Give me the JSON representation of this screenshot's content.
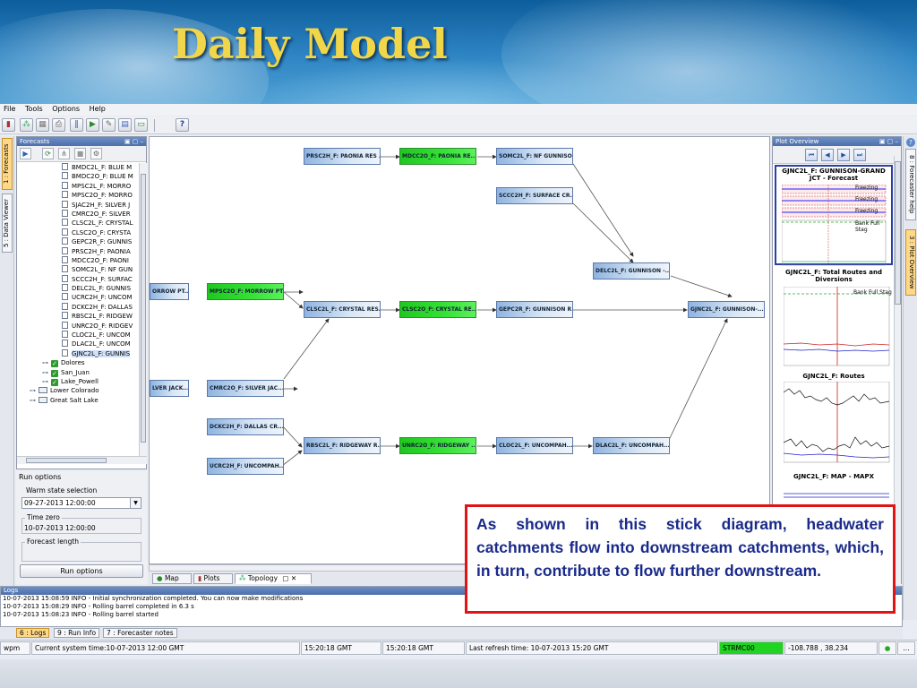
{
  "slide": {
    "title": "Daily Model"
  },
  "menu": [
    "File",
    "Tools",
    "Options",
    "Help"
  ],
  "toolbar": {
    "help_label": "?"
  },
  "left_tabs": [
    "1 : Forecasts",
    "5 : Data Viewer"
  ],
  "right_tabs": [
    "8 : Forecaster help",
    "3 : Plot Overview"
  ],
  "forecasts_panel": {
    "title": "Forecasts",
    "tree_items": [
      "BMDC2L_F: BLUE M",
      "BMDC2O_F: BLUE M",
      "MPSC2L_F: MORRO",
      "MPSC2O_F: MORRO",
      "SJAC2H_F: SILVER J",
      "CMRC2O_F: SILVER",
      "CLSC2L_F: CRYSTAL",
      "CLSC2O_F: CRYSTA",
      "GEPC2R_F: GUNNIS",
      "PRSC2H_F: PAONIA",
      "MDCC2O_F: PAONI",
      "SOMC2L_F: NF GUN",
      "SCCC2H_F: SURFAC",
      "DELC2L_F: GUNNIS",
      "UCRC2H_F: UNCOM",
      "DCKC2H_F: DALLAS",
      "RBSC2L_F: RIDGEW",
      "UNRC2O_F: RIDGEV",
      "CLOC2L_F: UNCOM",
      "DLAC2L_F: UNCOM",
      "GJNC2L_F: GUNNIS"
    ],
    "checked_groups": [
      "Dolores",
      "San_Juan",
      "Lake_Powell"
    ],
    "folder_groups": [
      "Lower Colorado",
      "Great Salt Lake"
    ]
  },
  "run_options": {
    "title": "Run options",
    "warm_state_label": "Warm state selection",
    "warm_state_value": "09-27-2013 12:00:00",
    "time_zero_label": "Time zero",
    "time_zero_value": "10-07-2013 12:00:00",
    "forecast_length_label": "Forecast length",
    "button_label": "Run options"
  },
  "topology_nodes": {
    "prsc2h": "PRSC2H_F: PAONIA RES ...",
    "mdcc2o": "MDCC2O_F: PAONIA RE...",
    "somc2l": "SOMC2L_F: NF GUNNISO...",
    "sccc2h": "SCCC2H_F: SURFACE CR...",
    "delc2l": "DELC2L_F: GUNNISON -...",
    "morrow": "ORROW PT...",
    "mpsc2o": "MPSC2O_F: MORROW PT...",
    "clsc2l": "CLSC2L_F: CRYSTAL RES...",
    "clsc2o": "CLSC2O_F: CRYSTAL RE...",
    "gepc2r": "GEPC2R_F: GUNNISON R...",
    "gjnc2l": "GJNC2L_F: GUNNISON-...",
    "silver": "LVER JACK...",
    "cmrc2o": "CMRC2O_F: SILVER JAC...",
    "dckc2h": "DCKC2H_F: DALLAS CR...",
    "rbsc2l": "RBSC2L_F: RIDGEWAY R...",
    "unrc2o": "UNRC2O_F: RIDGEWAY ...",
    "cloc2l": "CLOC2L_F: UNCOMPAH...",
    "dlac2l": "DLAC2L_F: UNCOMPAH...",
    "ucrc2h": "UCRC2H_F: UNCOMPAH..."
  },
  "bottom_tabs": [
    "Map",
    "Plots",
    "Topology"
  ],
  "plot_overview": {
    "title": "Plot Overview",
    "cards": [
      {
        "title": "GJNC2L_F: GUNNISON-GRAND JCT - Forecast",
        "labels": [
          "Freezing",
          "Freezing",
          "Freezing",
          "Bank Full Stag"
        ]
      },
      {
        "title": "GJNC2L_F: Total Routes and Diversions",
        "labels": [
          "Bank Full Stag"
        ]
      },
      {
        "title": "GJNC2L_F: Routes",
        "labels": []
      },
      {
        "title": "GJNC2L_F: MAP - MAPX",
        "labels": []
      }
    ]
  },
  "logs": {
    "title": "Logs",
    "lines": [
      "10-07-2013 15:08:59 INFO - Initial synchronization completed. You can now make modifications",
      "10-07-2013 15:08:29 INFO - Rolling barrel completed in 6.3 s",
      "10-07-2013 15:08:23 INFO - Rolling barrel started"
    ]
  },
  "log_tabs": [
    "6 : Logs",
    "9 : Run Info",
    "7 : Forecaster notes"
  ],
  "status": {
    "user": "wpm",
    "system_time": "Current system time:10-07-2013 12:00 GMT",
    "gmt1": "15:20:18 GMT",
    "gmt2": "15:20:18 GMT",
    "refresh": "Last refresh time: 10-07-2013 15:20 GMT",
    "selected_node": "STRMC00",
    "coords": "-108.788 , 38.234",
    "more": "...",
    "selected_color": "#22d422"
  },
  "callout": {
    "text": "As shown in this stick diagram, headwater catchments flow into downstream catchments, which, in turn, contribute to flow further downstream."
  }
}
